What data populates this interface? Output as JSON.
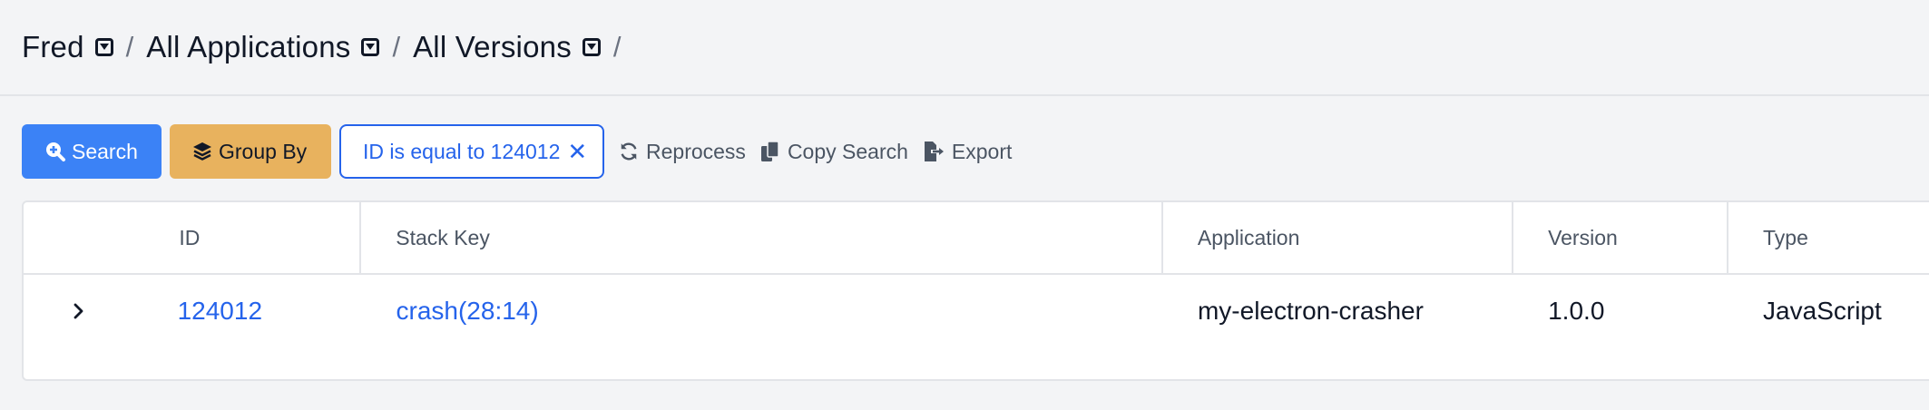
{
  "breadcrumb": {
    "items": [
      {
        "label": "Fred"
      },
      {
        "label": "All Applications"
      },
      {
        "label": "All Versions"
      }
    ],
    "separator": "/"
  },
  "toolbar": {
    "search_label": "Search",
    "group_by_label": "Group By",
    "filter_chip_label": "ID is equal to 124012",
    "filter_chip_close": "✕",
    "reprocess_label": "Reprocess",
    "copy_search_label": "Copy Search",
    "export_label": "Export"
  },
  "table": {
    "columns": [
      "ID",
      "Stack Key",
      "Application",
      "Version",
      "Type"
    ],
    "rows": [
      {
        "id": "124012",
        "stack_key": "crash(28:14)",
        "application": "my-electron-crasher",
        "version": "1.0.0",
        "type": "JavaScript"
      }
    ]
  },
  "colors": {
    "primary": "#3b82f6",
    "group_by": "#e8b25e",
    "link": "#2563eb",
    "background": "#f3f4f6"
  },
  "icons": {
    "search": "search-plus-icon",
    "group_by": "layers-icon",
    "reprocess": "refresh-icon",
    "copy": "copy-icon",
    "export": "export-icon",
    "crumb_dropdown": "caret-square-down-icon",
    "row_expand": "chevron-right-icon"
  }
}
